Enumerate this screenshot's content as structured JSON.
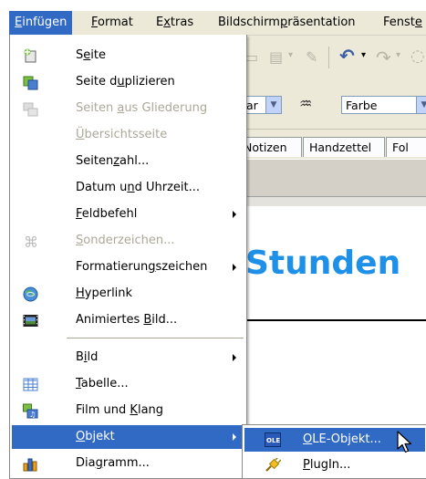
{
  "menubar": {
    "items": [
      {
        "label": "Einfügen",
        "mnemonic": "E",
        "rest": "infügen"
      },
      {
        "label": "Format",
        "mnemonic": "F",
        "rest": "ormat"
      },
      {
        "label": "Extras",
        "pre": "E",
        "mnemonic": "x",
        "rest": "tras"
      },
      {
        "label": "Bildschirmpräsentation",
        "pre": "Bildschirm",
        "mnemonic": "p",
        "rest": "räsentation"
      },
      {
        "label": "Fenste",
        "pre": "Fenst",
        "mnemonic": "e",
        "rest": ""
      }
    ]
  },
  "background": {
    "combo1_value": "ar",
    "combo2_value": "Farbe",
    "tabs": [
      "Notizen",
      "Handzettel",
      "Fol"
    ],
    "slide_title": "Stunden"
  },
  "menu": {
    "items": [
      {
        "label": "Seite",
        "pre": "S",
        "mnemonic": "e",
        "rest": "ite",
        "icon": "new-slide-icon",
        "enabled": true
      },
      {
        "label": "Seite duplizieren",
        "pre": "Seite d",
        "mnemonic": "u",
        "rest": "plizieren",
        "icon": "duplicate-slide-icon",
        "enabled": true
      },
      {
        "label": "Seiten aus Gliederung",
        "pre": "Seiten ",
        "mnemonic": "a",
        "rest": "us Gliederung",
        "icon": "outline-slides-icon",
        "enabled": false
      },
      {
        "label": "Übersichtsseite",
        "pre": "",
        "mnemonic": "Ü",
        "rest": "bersichtsseite",
        "enabled": false
      },
      {
        "label": "Seitenzahl...",
        "pre": "Seiten",
        "mnemonic": "z",
        "rest": "ahl...",
        "enabled": true
      },
      {
        "label": "Datum und Uhrzeit...",
        "pre": "Datum u",
        "mnemonic": "n",
        "rest": "d Uhrzeit...",
        "enabled": true
      },
      {
        "label": "Feldbefehl",
        "pre": "",
        "mnemonic": "F",
        "rest": "eldbefehl",
        "enabled": true,
        "submenu": true
      },
      {
        "label": "Sonderzeichen...",
        "pre": "",
        "mnemonic": "S",
        "rest": "onderzeichen...",
        "icon": "special-character-icon",
        "enabled": false
      },
      {
        "label": "Formatierungszeichen",
        "pre": "Formatierun",
        "mnemonic": "g",
        "rest": "szeichen",
        "enabled": true,
        "submenu": true
      },
      {
        "label": "Hyperlink",
        "pre": "",
        "mnemonic": "H",
        "rest": "yperlink",
        "icon": "hyperlink-globe-icon",
        "enabled": true
      },
      {
        "label": "Animiertes Bild...",
        "pre": "Animiertes ",
        "mnemonic": "B",
        "rest": "ild...",
        "icon": "film-strip-icon",
        "enabled": true
      },
      {
        "label": "Bild",
        "pre": "B",
        "mnemonic": "i",
        "rest": "ld",
        "enabled": true,
        "submenu": true
      },
      {
        "label": "Tabelle...",
        "pre": "",
        "mnemonic": "T",
        "rest": "abelle...",
        "icon": "table-icon",
        "enabled": true
      },
      {
        "label": "Film und Klang",
        "pre": "Film und ",
        "mnemonic": "K",
        "rest": "lang",
        "icon": "film-sound-icon",
        "enabled": true
      },
      {
        "label": "Objekt",
        "pre": "",
        "mnemonic": "O",
        "rest": "bjekt",
        "enabled": true,
        "submenu": true,
        "selected": true
      },
      {
        "label": "Diagramm...",
        "pre": "Dia",
        "mnemonic": "g",
        "rest": "ramm...",
        "icon": "chart-icon",
        "enabled": true
      }
    ]
  },
  "submenu": {
    "items": [
      {
        "label": "OLE-Objekt...",
        "pre": "",
        "mnemonic": "O",
        "rest": "LE-Objekt...",
        "icon": "ole-object-icon",
        "icon_text": "OLE",
        "selected": true
      },
      {
        "label": "PlugIn...",
        "pre": "",
        "mnemonic": "P",
        "rest": "lugIn...",
        "icon": "plugin-icon"
      }
    ]
  },
  "colors": {
    "selection": "#316ac5",
    "menubar_bg": "#ece9d8",
    "disabled_text": "#aca899",
    "slide_title": "#1e90e8"
  }
}
